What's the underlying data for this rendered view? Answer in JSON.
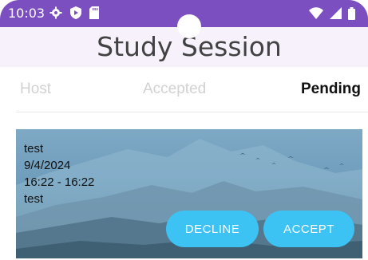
{
  "status_bar": {
    "time": "10:03",
    "left_icons": [
      "settings-icon",
      "shield-play-icon",
      "sd-card-icon"
    ],
    "right_icons": [
      "wifi-icon",
      "signal-icon",
      "battery-icon"
    ],
    "bg_color": "#7b4fbf"
  },
  "header": {
    "title": "Study Session"
  },
  "tabs": [
    {
      "label": "Host",
      "selected": false
    },
    {
      "label": "Accepted",
      "selected": false
    },
    {
      "label": "Pending",
      "selected": true
    }
  ],
  "session_card": {
    "name": "test",
    "date": "9/4/2024",
    "time_range": "16:22 - 16:22",
    "location": "test",
    "decline_label": "DECLINE",
    "accept_label": "ACCEPT",
    "button_color": "#3cc3f3"
  }
}
